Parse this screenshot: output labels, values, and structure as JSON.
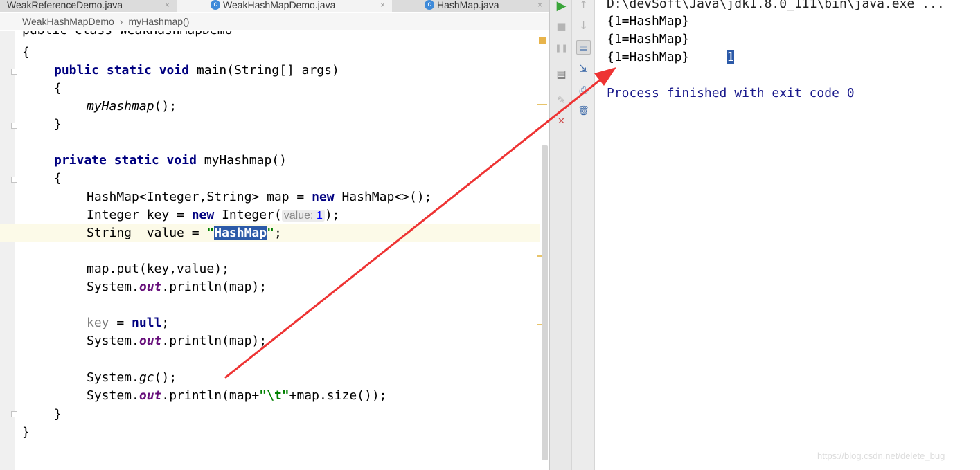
{
  "tabs": [
    {
      "label": "WeakReferenceDemo.java",
      "icon": "",
      "close": "×"
    },
    {
      "label": "WeakHashMapDemo.java",
      "icon": "c",
      "close": "×"
    },
    {
      "label": "HashMap.java",
      "icon": "c",
      "close": "×"
    }
  ],
  "breadcrumb": {
    "class_name": "WeakHashMapDemo",
    "separator": "›",
    "method_name": "myHashmap()"
  },
  "code": {
    "l0": "public class WeakHashMapDemo",
    "l1": "{",
    "l2_kw": "public static void ",
    "l2_rest": "main(String[] args)",
    "l3": "{",
    "l4_call": "myHashmap",
    "l4_rest": "();",
    "l5": "}",
    "l7_kw": "private static void ",
    "l7_rest": "myHashmap()",
    "l8": "{",
    "l9_a": "HashMap<Integer,String> map = ",
    "l9_kw": "new",
    "l9_b": " HashMap<>();",
    "l10_a": "Integer key = ",
    "l10_kw": "new",
    "l10_b": " Integer(",
    "l10_hint_label": "value:",
    "l10_hint_value": "1",
    "l10_c": ");",
    "l11_a": "String  value = ",
    "l11_q1": "\"",
    "l11_sel": "HashMap",
    "l11_q2": "\"",
    "l11_end": ";",
    "l13": "map.put(key,value);",
    "l14_a": "System.",
    "l14_out": "out",
    "l14_b": ".println(map);",
    "l16_a": "key",
    "l16_b": " = ",
    "l16_kw": "null",
    "l16_c": ";",
    "l17_a": "System.",
    "l17_out": "out",
    "l17_b": ".println(map);",
    "l19_a": "System.",
    "l19_gc": "gc",
    "l19_b": "();",
    "l20_a": "System.",
    "l20_out": "out",
    "l20_b": ".println(map+",
    "l20_str": "\"\\t\"",
    "l20_c": "+map.size());",
    "l21": "}",
    "l22": "}"
  },
  "run_toolbar": {
    "run_icon": "▶",
    "stop_icon": "■",
    "pause_icon": "❚❚",
    "layout_icon": "▤",
    "pin_icon": "✎",
    "close_icon": "✕",
    "up_icon": "↑",
    "down_icon": "↓",
    "wrap_icon": "≡",
    "scroll_end_icon": "⇲",
    "print_icon": "⎙",
    "trash_icon": "🗑"
  },
  "console": {
    "command": "D:\\devSoft\\Java\\jdk1.8.0_111\\bin\\java.exe ...",
    "out1": "{1=HashMap}",
    "out2": "{1=HashMap}",
    "out3": "{1=HashMap}\t",
    "out3_selected": "1",
    "exit": "Process finished with exit code 0"
  },
  "watermark": "https://blog.csdn.net/delete_bug",
  "colors": {
    "keyword": "#000080",
    "static_field": "#660e7a",
    "string": "#008000",
    "selection": "#2c5aa8",
    "arrow": "#ee3333"
  }
}
